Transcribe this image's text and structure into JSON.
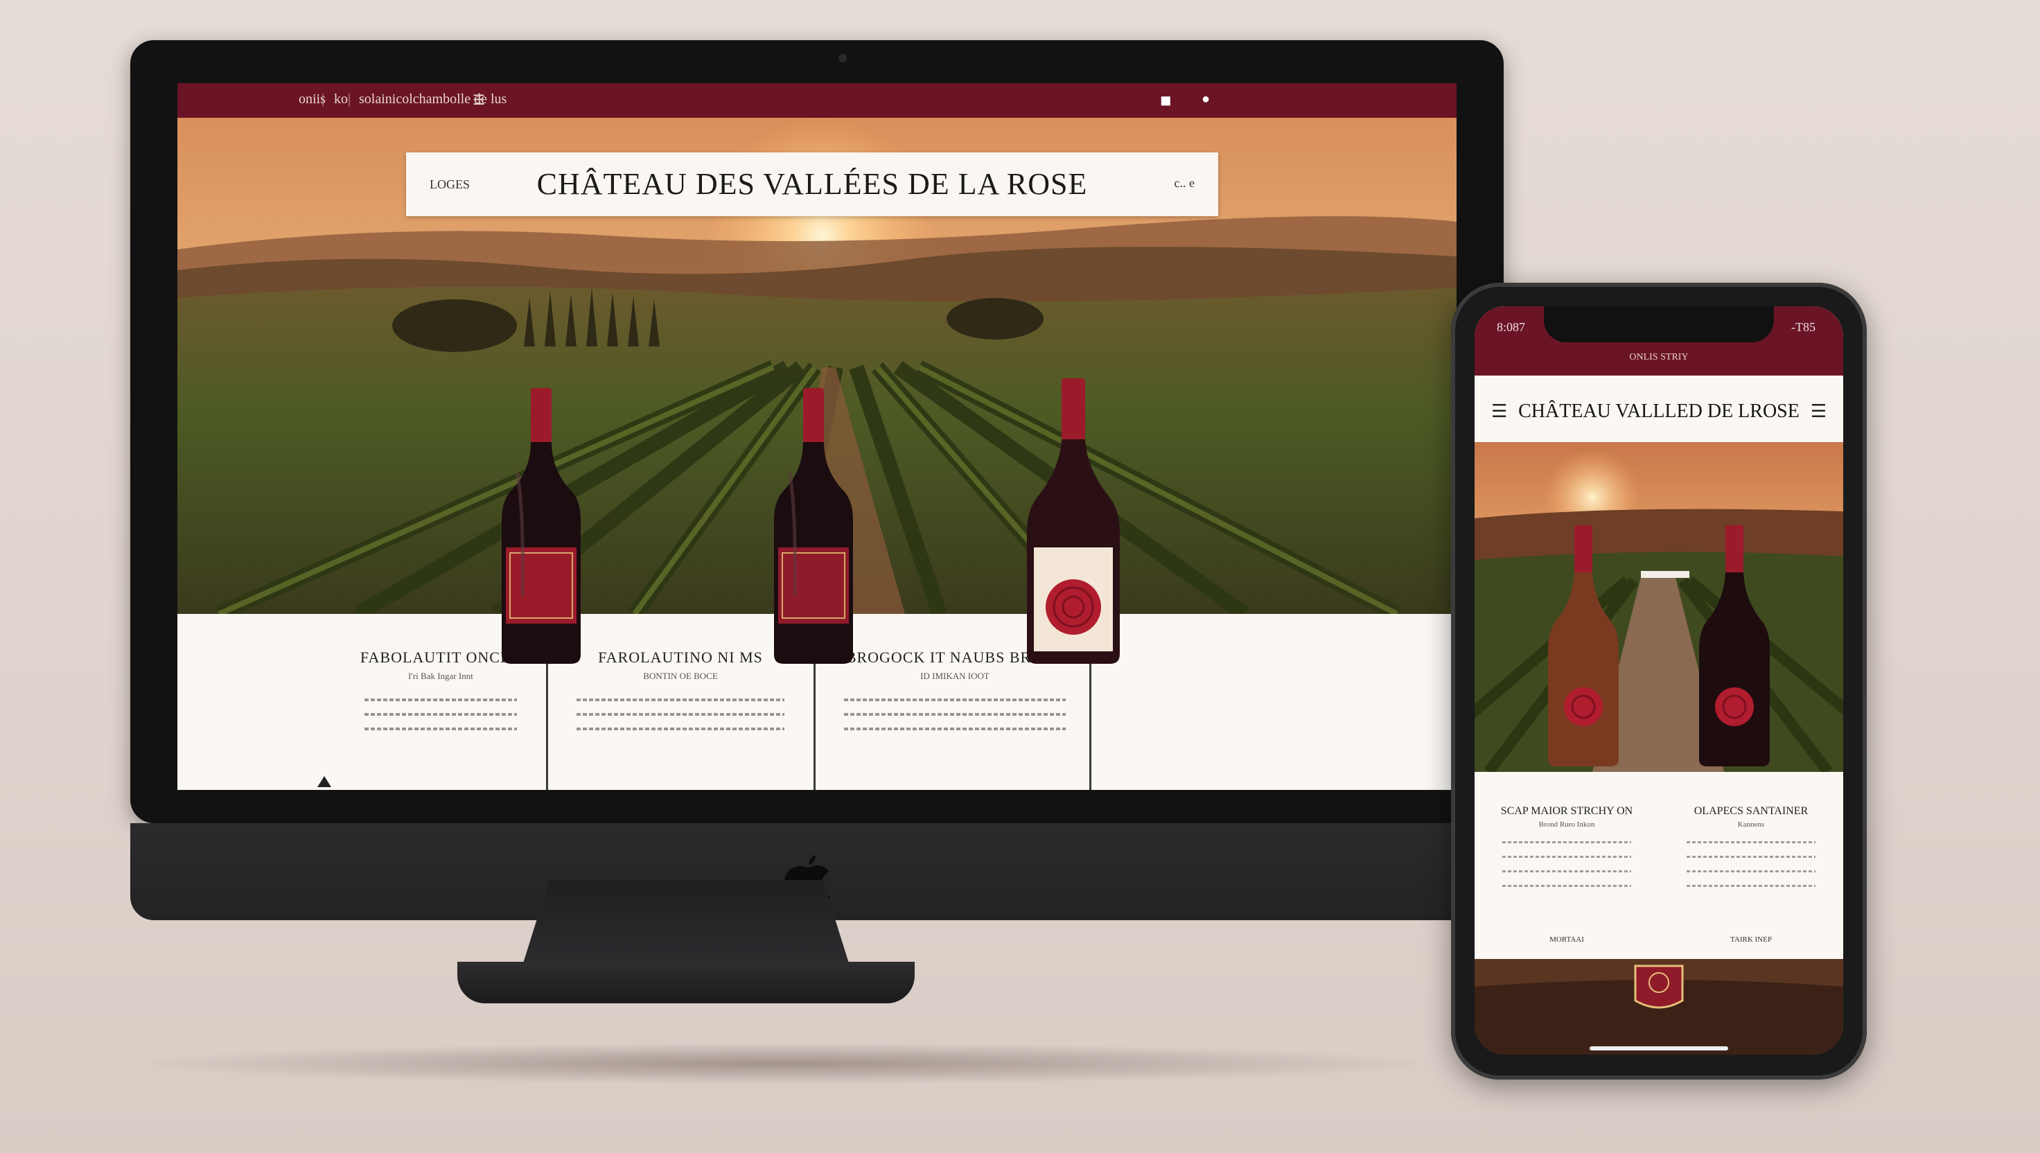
{
  "desktop_site": {
    "topbar": {
      "item_1": "oniis",
      "separator_1": "|",
      "item_2": "ko",
      "separator_2": "|",
      "item_3": "solainicolchambolle de lus",
      "menu_glyph": "☰",
      "icon_1": "◼",
      "icon_2": "●"
    },
    "header": {
      "left_text": "LOGES",
      "site_title": "CHÂTEAU DES VALLÉES DE LA ROSE",
      "right_text": "c.. e"
    },
    "products": [
      {
        "name": "FABOLAUTIT ONCHS",
        "subtitle": "I'ri Bak Ingar Innt"
      },
      {
        "name": "FAROLAUTINO NI MS",
        "subtitle": "BONTIN OE BOCE"
      },
      {
        "name": "BROGOCK IT NAUBS BRUKS",
        "subtitle": "ID IMIKAN IOOT"
      }
    ]
  },
  "mobile_site": {
    "status_time": "8:087",
    "status_right": "‑T85",
    "subheader": "ONLIS STRIY",
    "site_title": "CHÂTEAU VALLLED DE LROSE",
    "menu_left_icon": "☰",
    "menu_right_icon": "☰",
    "products": [
      {
        "name": "SCAP MAIOR STRCHY ON",
        "subtitle": "Brond Ruro Inkon",
        "footer": "MORTAAI"
      },
      {
        "name": "OLAPECS SANTAINER",
        "subtitle": "Kannens",
        "footer": "TAIRK INEP"
      }
    ]
  },
  "colors": {
    "burgundy": "#6a1426",
    "wine_label_red": "#9b1b2b",
    "cream": "#fbf8f4",
    "device_black": "#121212"
  }
}
